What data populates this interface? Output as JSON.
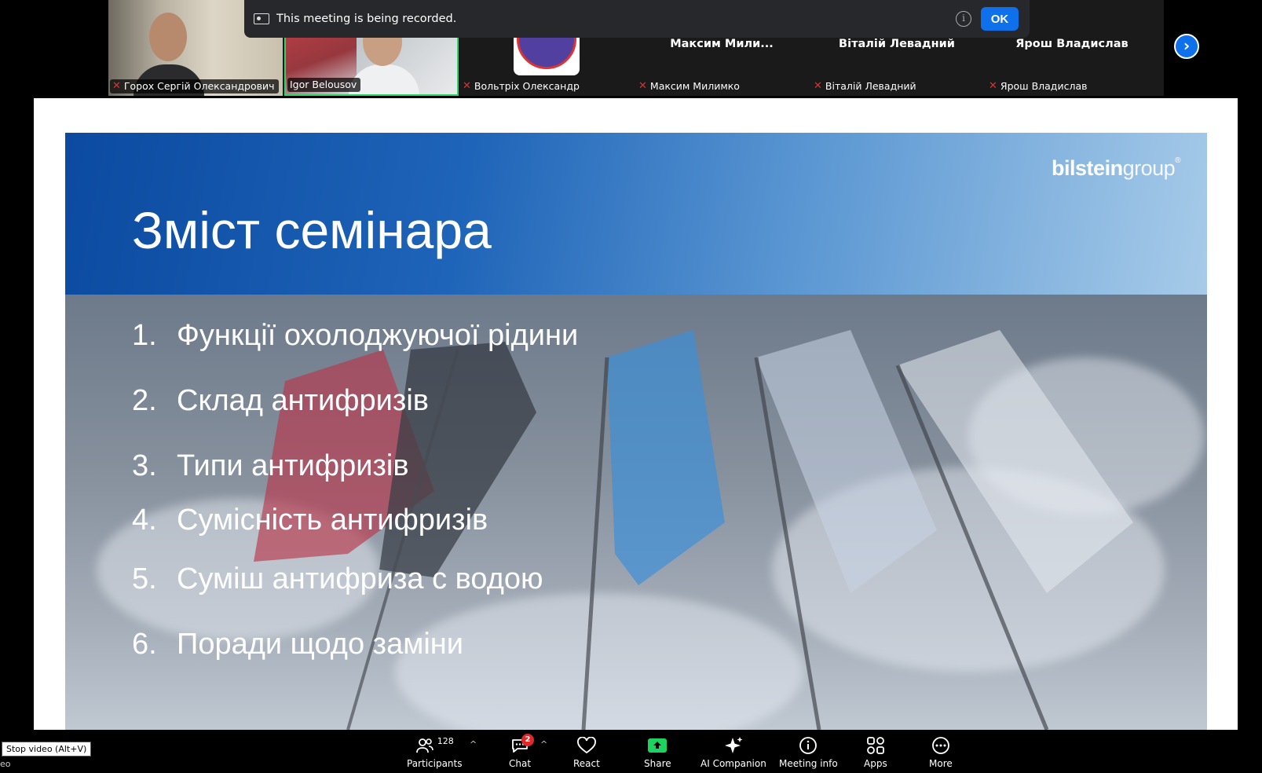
{
  "recording_banner": {
    "text": "This meeting is being recorded.",
    "info_glyph": "i",
    "ok_label": "OK"
  },
  "participants": [
    {
      "name": "Горох Сергій Олександрович",
      "type": "video",
      "muted": true
    },
    {
      "name": "Igor Belousov",
      "type": "video",
      "muted": false,
      "active_speaker": true
    },
    {
      "name": "Вольтріх Олександр",
      "type": "avatar",
      "muted": true
    },
    {
      "name": "Максим Милимко",
      "display": "Максим  Мили...",
      "type": "name",
      "muted": true
    },
    {
      "name": "Віталій Левадний",
      "display": "Віталій Левадний",
      "type": "name",
      "muted": true
    },
    {
      "name": "Ярош Владислав",
      "display": "Ярош Владислав",
      "type": "name",
      "muted": true
    }
  ],
  "next_page_glyph": "›",
  "slide": {
    "title": "Зміст семінара",
    "logo_bold": "bilstein",
    "logo_light": "group",
    "logo_mark": "®",
    "agenda": [
      {
        "num": "1.",
        "text": "Функції охолоджуючої рідини"
      },
      {
        "num": "2.",
        "text": "Склад антифризів"
      },
      {
        "num": "3.",
        "text": "Типи антифризів"
      },
      {
        "num": "4.",
        "text": "Сумісність антифризів"
      },
      {
        "num": "5.",
        "text": "Суміш антифриза с водою"
      },
      {
        "num": "6.",
        "text": "Поради щодо заміни"
      }
    ]
  },
  "toolbar": {
    "participants_label": "Participants",
    "participants_count": "128",
    "chat_label": "Chat",
    "chat_badge": "2",
    "react_label": "React",
    "share_label": "Share",
    "ai_label": "AI Companion",
    "info_label": "Meeting info",
    "apps_label": "Apps",
    "more_label": "More",
    "caret": "^"
  },
  "tooltip": "Stop video (Alt+V)",
  "left_fragment": "eo",
  "colors": {
    "accent": "#0e71eb",
    "active_speaker": "#2fd36b",
    "muted": "#e03131",
    "share_green": "#1dd35f"
  }
}
